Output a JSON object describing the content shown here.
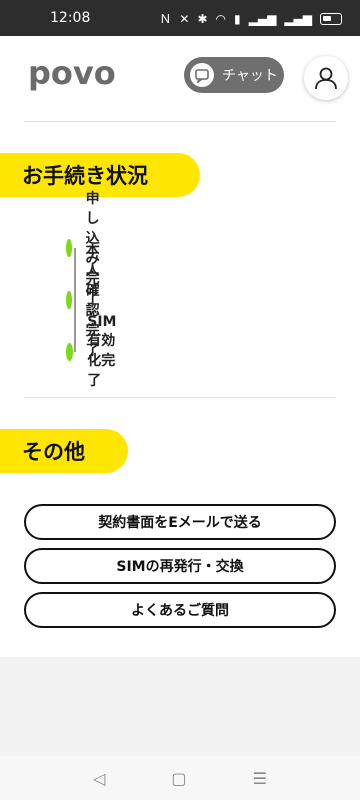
{
  "status_bar": {
    "time": "12:08",
    "icons": [
      "nfc-icon",
      "mute-icon",
      "bluetooth-icon",
      "wifi-icon",
      "data-icon",
      "signal-icon",
      "signal-icon",
      "battery-icon"
    ]
  },
  "header": {
    "logo_text": "povo",
    "chat_label": "チャット"
  },
  "procedure": {
    "title": "お手続き状況",
    "steps": [
      "申し込み完了",
      "本人確認完了",
      "SIM有効化完了"
    ],
    "step_color": "#7dd916"
  },
  "other": {
    "title": "その他",
    "buttons": [
      "契約書面をEメールで送る",
      "SIMの再発行・交換",
      "よくあるご質問"
    ]
  },
  "colors": {
    "accent": "#ffe600",
    "chat_bg": "#6f6f6f"
  }
}
